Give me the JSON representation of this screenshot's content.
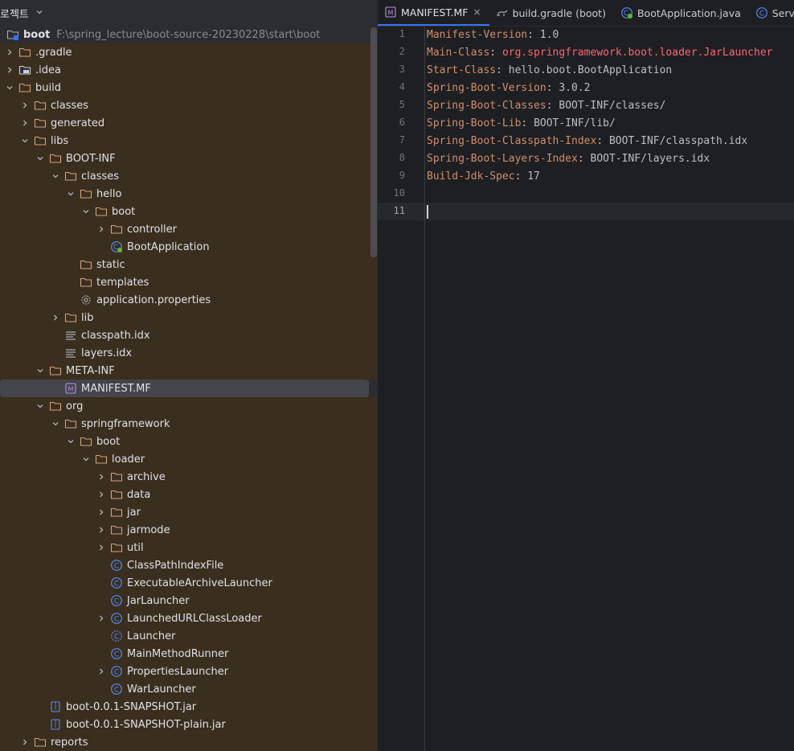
{
  "panel": {
    "title": "로젝트",
    "root": "boot",
    "root_path": "F:\\spring_lecture\\boot-source-20230228\\start\\boot"
  },
  "tree": [
    {
      "label": ".gradle",
      "level": 1,
      "arrow": "right",
      "icon": "folder",
      "row": "brown"
    },
    {
      "label": ".idea",
      "level": 1,
      "arrow": "right",
      "icon": "folder-dark",
      "row": "brown"
    },
    {
      "label": "build",
      "level": 1,
      "arrow": "down",
      "icon": "folder",
      "row": "brown"
    },
    {
      "label": "classes",
      "level": 2,
      "arrow": "right",
      "icon": "folder",
      "row": "brown"
    },
    {
      "label": "generated",
      "level": 2,
      "arrow": "right",
      "icon": "folder",
      "row": "brown"
    },
    {
      "label": "libs",
      "level": 2,
      "arrow": "down",
      "icon": "folder",
      "row": "brown"
    },
    {
      "label": "BOOT-INF",
      "level": 3,
      "arrow": "down",
      "icon": "folder",
      "row": "brown"
    },
    {
      "label": "classes",
      "level": 4,
      "arrow": "down",
      "icon": "folder",
      "row": "brown"
    },
    {
      "label": "hello",
      "level": 5,
      "arrow": "down",
      "icon": "folder",
      "row": "brown"
    },
    {
      "label": "boot",
      "level": 6,
      "arrow": "down",
      "icon": "folder",
      "row": "brown"
    },
    {
      "label": "controller",
      "level": 7,
      "arrow": "right",
      "icon": "folder",
      "row": "brown"
    },
    {
      "label": "BootApplication",
      "level": 7,
      "arrow": "none",
      "icon": "spring-class",
      "row": "brown"
    },
    {
      "label": "static",
      "level": 5,
      "arrow": "none",
      "icon": "folder",
      "row": "brown"
    },
    {
      "label": "templates",
      "level": 5,
      "arrow": "none",
      "icon": "folder",
      "row": "brown"
    },
    {
      "label": "application.properties",
      "level": 5,
      "arrow": "none",
      "icon": "gear",
      "row": "brown"
    },
    {
      "label": "lib",
      "level": 4,
      "arrow": "right",
      "icon": "folder",
      "row": "brown"
    },
    {
      "label": "classpath.idx",
      "level": 4,
      "arrow": "none",
      "icon": "text-file",
      "row": "brown"
    },
    {
      "label": "layers.idx",
      "level": 4,
      "arrow": "none",
      "icon": "text-file",
      "row": "brown"
    },
    {
      "label": "META-INF",
      "level": 3,
      "arrow": "down",
      "icon": "folder",
      "row": "brown"
    },
    {
      "label": "MANIFEST.MF",
      "level": 4,
      "arrow": "none",
      "icon": "manifest",
      "row": "sel"
    },
    {
      "label": "org",
      "level": 3,
      "arrow": "down",
      "icon": "folder",
      "row": "brown"
    },
    {
      "label": "springframework",
      "level": 4,
      "arrow": "down",
      "icon": "folder",
      "row": "brown"
    },
    {
      "label": "boot",
      "level": 5,
      "arrow": "down",
      "icon": "folder",
      "row": "brown"
    },
    {
      "label": "loader",
      "level": 6,
      "arrow": "down",
      "icon": "folder",
      "row": "brown"
    },
    {
      "label": "archive",
      "level": 7,
      "arrow": "right",
      "icon": "folder",
      "row": "brown"
    },
    {
      "label": "data",
      "level": 7,
      "arrow": "right",
      "icon": "folder",
      "row": "brown"
    },
    {
      "label": "jar",
      "level": 7,
      "arrow": "right",
      "icon": "folder",
      "row": "brown"
    },
    {
      "label": "jarmode",
      "level": 7,
      "arrow": "right",
      "icon": "folder",
      "row": "brown"
    },
    {
      "label": "util",
      "level": 7,
      "arrow": "right",
      "icon": "folder",
      "row": "brown"
    },
    {
      "label": "ClassPathIndexFile",
      "level": 7,
      "arrow": "none",
      "icon": "class",
      "row": "brown"
    },
    {
      "label": "ExecutableArchiveLauncher",
      "level": 7,
      "arrow": "none",
      "icon": "class",
      "row": "brown"
    },
    {
      "label": "JarLauncher",
      "level": 7,
      "arrow": "none",
      "icon": "class",
      "row": "brown"
    },
    {
      "label": "LaunchedURLClassLoader",
      "level": 7,
      "arrow": "right",
      "icon": "class",
      "row": "brown"
    },
    {
      "label": "Launcher",
      "level": 7,
      "arrow": "none",
      "icon": "abstract-class",
      "row": "brown"
    },
    {
      "label": "MainMethodRunner",
      "level": 7,
      "arrow": "none",
      "icon": "class",
      "row": "brown"
    },
    {
      "label": "PropertiesLauncher",
      "level": 7,
      "arrow": "right",
      "icon": "class",
      "row": "brown"
    },
    {
      "label": "WarLauncher",
      "level": 7,
      "arrow": "none",
      "icon": "class",
      "row": "brown"
    },
    {
      "label": "boot-0.0.1-SNAPSHOT.jar",
      "level": 3,
      "arrow": "none",
      "icon": "jar",
      "row": "brown"
    },
    {
      "label": "boot-0.0.1-SNAPSHOT-plain.jar",
      "level": 3,
      "arrow": "none",
      "icon": "jar",
      "row": "brown"
    },
    {
      "label": "reports",
      "level": 2,
      "arrow": "right",
      "icon": "folder",
      "row": "brown"
    }
  ],
  "tabs": [
    {
      "label": "MANIFEST.MF",
      "icon": "manifest",
      "active": true,
      "close": "×"
    },
    {
      "label": "build.gradle (boot)",
      "icon": "gradle",
      "active": false,
      "close": ""
    },
    {
      "label": "BootApplication.java",
      "icon": "spring-class",
      "active": false,
      "close": ""
    },
    {
      "label": "ServletWe",
      "icon": "class",
      "active": false,
      "close": ""
    }
  ],
  "editor": {
    "lines": [
      {
        "n": "1",
        "key": "Manifest-Version",
        "val": "1.0",
        "val_style": "plain"
      },
      {
        "n": "2",
        "key": "Main-Class",
        "val": "org.springframework.boot.loader.JarLauncher",
        "val_style": "red"
      },
      {
        "n": "3",
        "key": "Start-Class",
        "val": "hello.boot.BootApplication",
        "val_style": "plain"
      },
      {
        "n": "4",
        "key": "Spring-Boot-Version",
        "val": "3.0.2",
        "val_style": "plain"
      },
      {
        "n": "5",
        "key": "Spring-Boot-Classes",
        "val": "BOOT-INF/classes/",
        "val_style": "plain"
      },
      {
        "n": "6",
        "key": "Spring-Boot-Lib",
        "val": "BOOT-INF/lib/",
        "val_style": "plain"
      },
      {
        "n": "7",
        "key": "Spring-Boot-Classpath-Index",
        "val": "BOOT-INF/classpath.idx",
        "val_style": "plain"
      },
      {
        "n": "8",
        "key": "Spring-Boot-Layers-Index",
        "val": "BOOT-INF/layers.idx",
        "val_style": "plain"
      },
      {
        "n": "9",
        "key": "Build-Jdk-Spec",
        "val": "17",
        "val_style": "plain"
      },
      {
        "n": "10",
        "key": "",
        "val": "",
        "val_style": "plain"
      },
      {
        "n": "11",
        "key": "",
        "val": "",
        "val_style": "plain"
      }
    ],
    "current_line": "11"
  },
  "colors": {
    "folder": "#d6a17a",
    "class": "#548af7",
    "manifest": "#b88fe0",
    "accent": "#3574f0"
  }
}
